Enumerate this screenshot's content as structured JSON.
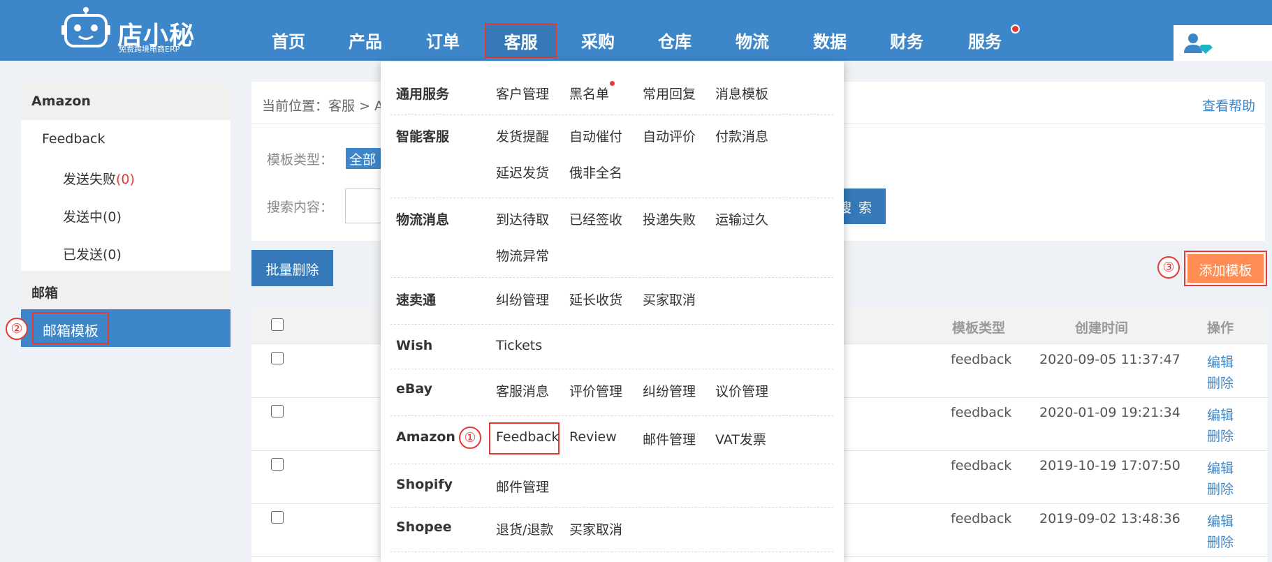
{
  "logo": {
    "name": "店小秘",
    "tagline": "免费跨境电商ERP"
  },
  "nav": [
    {
      "label": "首页"
    },
    {
      "label": "产品"
    },
    {
      "label": "订单"
    },
    {
      "label": "客服"
    },
    {
      "label": "采购"
    },
    {
      "label": "仓库"
    },
    {
      "label": "物流"
    },
    {
      "label": "数据"
    },
    {
      "label": "财务"
    },
    {
      "label": "服务"
    }
  ],
  "nav_active": "客服",
  "sidebar": {
    "group1": "Amazon",
    "item_feedback": "Feedback",
    "sub": [
      {
        "label": "发送失败",
        "count": "(0)"
      },
      {
        "label": "发送中(0)"
      },
      {
        "label": "已发送(0)"
      }
    ],
    "group2": "邮箱",
    "active_item": "邮箱模板"
  },
  "breadcrumb": "当前位置：客服 > A",
  "help_link": "查看帮助",
  "filters": {
    "type_label": "模板类型：",
    "type_chip": "全部",
    "search_label": "搜索内容：",
    "search_button": "搜 索"
  },
  "buttons": {
    "batch_delete": "批量删除",
    "add_template": "添加模板"
  },
  "markers": {
    "m1": "①",
    "m2": "②",
    "m3": "③"
  },
  "table": {
    "headers": {
      "type": "模板类型",
      "created": "创建时间",
      "action": "操作"
    },
    "rows": [
      {
        "type": "feedback",
        "created": "2020-09-05 11:37:47",
        "edit": "编辑",
        "delete": "删除"
      },
      {
        "type": "feedback",
        "created": "2020-01-09 19:21:34",
        "edit": "编辑",
        "delete": "删除"
      },
      {
        "type": "feedback",
        "created": "2019-10-19 17:07:50",
        "edit": "编辑",
        "delete": "删除"
      },
      {
        "type": "feedback",
        "created": "2019-09-02 13:48:36",
        "edit": "编辑",
        "delete": "删除"
      }
    ]
  },
  "dropdown": {
    "sections": [
      {
        "category": "通用服务",
        "lines": [
          [
            "客户管理",
            "黑名单",
            "常用回复",
            "消息模板"
          ]
        ]
      },
      {
        "category": "智能客服",
        "lines": [
          [
            "发货提醒",
            "自动催付",
            "自动评价",
            "付款消息"
          ],
          [
            "延迟发货",
            "俄非全名"
          ]
        ]
      },
      {
        "category": "物流消息",
        "lines": [
          [
            "到达待取",
            "已经签收",
            "投递失败",
            "运输过久"
          ],
          [
            "物流异常"
          ]
        ]
      },
      {
        "category": "速卖通",
        "lines": [
          [
            "纠纷管理",
            "延长收货",
            "买家取消"
          ]
        ]
      },
      {
        "category": "Wish",
        "lines": [
          [
            "Tickets"
          ]
        ]
      },
      {
        "category": "eBay",
        "lines": [
          [
            "客服消息",
            "评价管理",
            "纠纷管理",
            "议价管理"
          ]
        ]
      },
      {
        "category": "Amazon",
        "lines": [
          [
            "Feedback",
            "Review",
            "邮件管理",
            "VAT发票"
          ]
        ]
      },
      {
        "category": "Shopify",
        "lines": [
          [
            "邮件管理"
          ]
        ]
      },
      {
        "category": "Shopee",
        "lines": [
          [
            "退货/退款",
            "买家取消"
          ]
        ]
      }
    ]
  }
}
